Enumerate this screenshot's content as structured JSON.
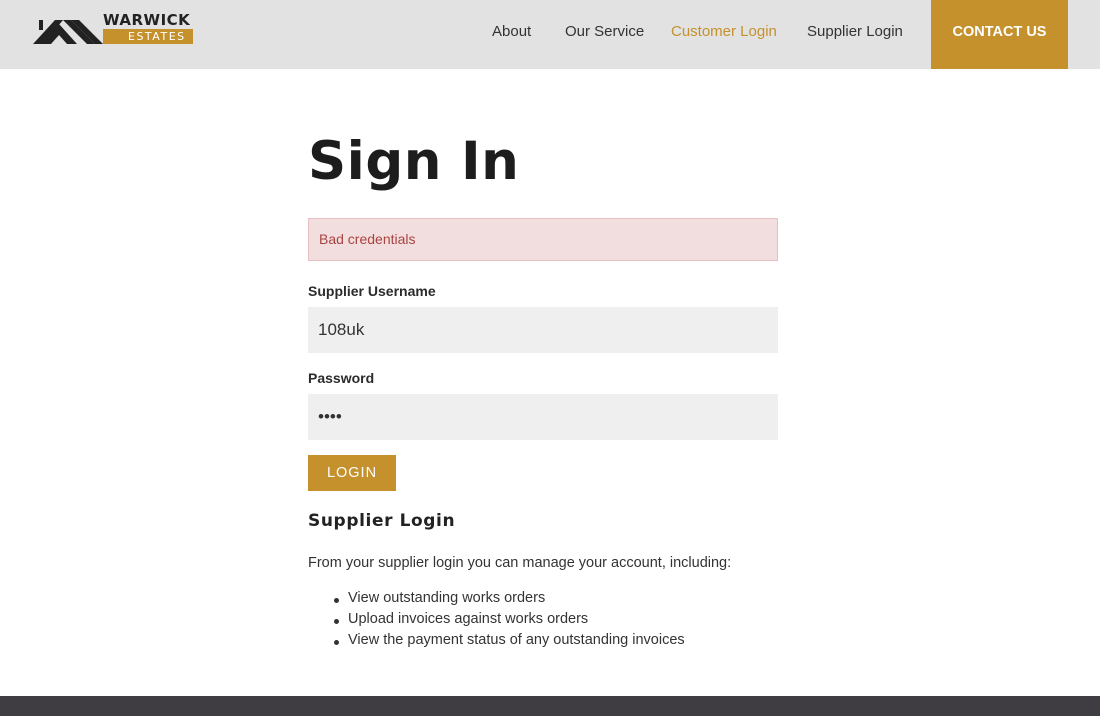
{
  "brand": {
    "name_top": "WARWICK",
    "name_bottom": "ESTATES",
    "icon": "roof-logo-icon",
    "accent_color": "#c4912d"
  },
  "nav": {
    "items": [
      {
        "label": "About",
        "active": false
      },
      {
        "label": "Our Service",
        "active": false
      },
      {
        "label": "Customer Login",
        "active": true
      },
      {
        "label": "Supplier Login",
        "active": false
      }
    ],
    "contact_label": "CONTACT US"
  },
  "page": {
    "title": "Sign In",
    "alert": "Bad credentials",
    "username_label": "Supplier Username",
    "username_value": "108uk",
    "password_label": "Password",
    "password_value": "••••",
    "login_label": "LOGIN",
    "info_title": "Supplier Login",
    "info_intro": "From your supplier login you can manage your account, including:",
    "info_items": [
      "View outstanding works orders",
      "Upload invoices against works orders",
      "View the payment status of any outstanding invoices"
    ]
  }
}
